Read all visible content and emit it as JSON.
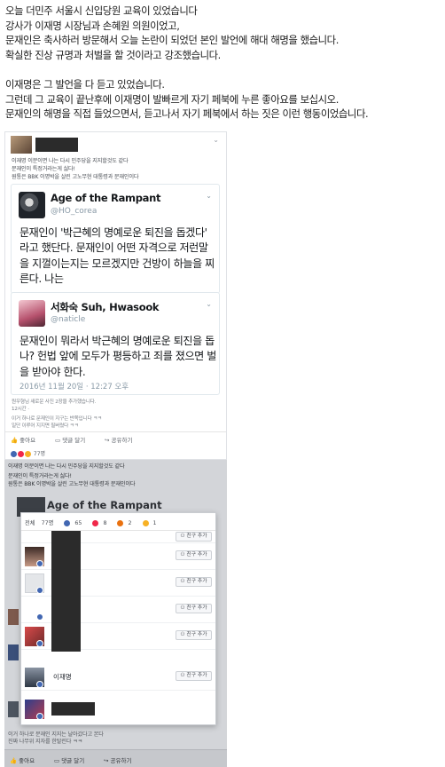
{
  "intro": {
    "lines": [
      "오늘 더민주 서울시 신입당원 교육이 있었습니다",
      "강사가 이재명 시장님과 손혜원 의원이었고,",
      "문재인은 축사하러 방문해서 오늘 논란이 되었던 본인 발언에 해대 해명을 했습니다.",
      "확실한 진상 규명과 처벌을 할 것이라고 강조했습니다.",
      "",
      "이재명은 그 발언을 다 듣고 있었습니다.",
      "그런데 그 교육이 끝난후에 이재명이 발빠르게 자기 페북에 누른 좋아요를 보십시오.",
      "문재인의 해명을 직접 들었으면서, 듣고나서 자기 페북에서 하는 짓은 이런 행동이었습니다."
    ]
  },
  "post1": {
    "line1": "이재명 이분이면 나는 다시 민주당을 지지할것도 같다",
    "line2": "문재인이 특정거라는게 싫다!",
    "line3": "원통은 BBK 이명박을 살린 고노무현 대통령과 문재인이다",
    "tweet1": {
      "name": "Age of the Rampant",
      "handle": "@HO_corea",
      "text": "문재인이 '박근혜의 명예로운 퇴진을 돕겠다' 라고 했단다. 문재인이 어떤 자격으로 저런말을 지껄이는지는 모르겠지만 건방이 하늘을 찌른다. 나는"
    },
    "tweet2": {
      "name": "서화숙 Suh, Hwasook",
      "handle": "@naticle",
      "text": "문재인이 뭐라서 박근혜의 명예로운 퇴진을 돕나? 헌법 앞에 모두가 평등하고 죄를 졌으면 벌을 받아야 한다.",
      "date": "2016년 11월 20일 · 12:27 오후"
    },
    "foot1": "원우형님 새로운 사진 2장을 추가했습니다.",
    "foot2": "12시간 · ",
    "foot3": "이거 하나로 문재인이 지구는 반쪽입니다 ㅋㅋ",
    "foot4": "일단 이루어 지지면 필버렸다 ㅋㅋ",
    "actions": {
      "like": "좋아요",
      "comment": "댓글 달기",
      "share": "공유하기"
    },
    "reactions_count": "77명"
  },
  "shot2": {
    "line1": "이재명 이분이면 나는 다시 민주당을 지지할것도 같다",
    "line2": "문재인이 특정거라는게 싫다!",
    "line3": "원통은 BBK 이명박을 살린 고노무현 대통령과 문재인이다",
    "bg_name": "Age of the Rampant",
    "foot_a": "이거 하나로 문재인 지지는 날아갔다고 본다",
    "foot_b": "진짜 나무위 지자를 한탈린다 ㅋㅋ",
    "actions": {
      "like": "좋아요",
      "comment": "댓글 달기",
      "share": "공유하기"
    },
    "popup": {
      "tabs": [
        "77명",
        "65",
        "8",
        "2",
        "1"
      ],
      "rows": [
        {
          "name": "",
          "button": "친구 추가"
        },
        {
          "name": "",
          "button": "친구 추가"
        },
        {
          "name": "",
          "button": "친구 추가"
        },
        {
          "name": "",
          "button": "친구 추가"
        },
        {
          "name": "",
          "button": "친구 추가"
        },
        {
          "name": "이재명",
          "button": "친구 추가"
        },
        {
          "name": "",
          "button": ""
        }
      ]
    }
  },
  "colors": {
    "like_blue": "#4267b2",
    "love_red": "#f0284a",
    "tweet_gray": "#8899a6"
  },
  "icons": [
    "chevron-down-icon",
    "like-icon",
    "comment-icon",
    "share-icon",
    "add-friend-icon"
  ]
}
